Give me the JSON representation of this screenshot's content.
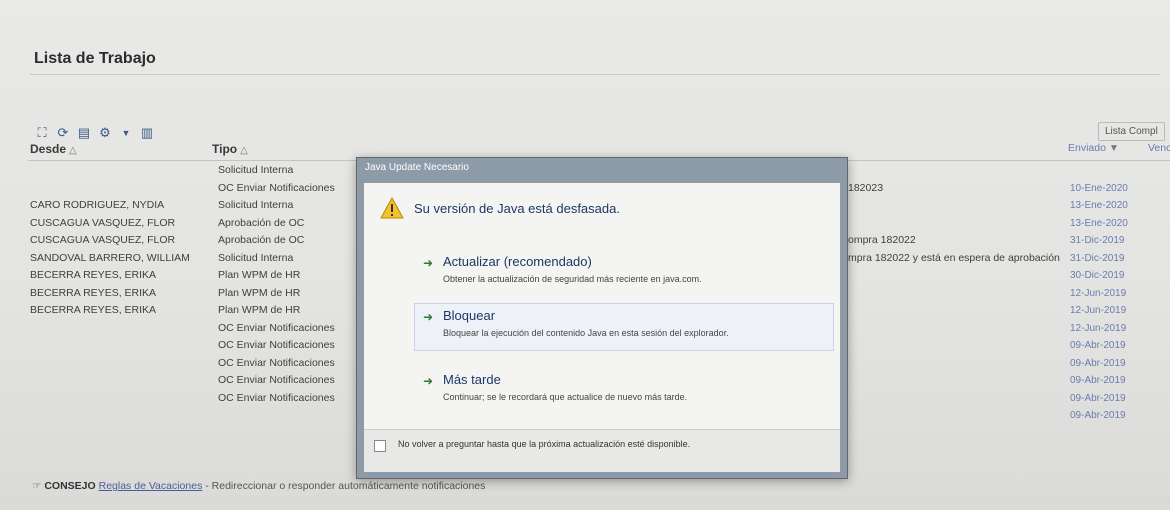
{
  "page": {
    "title": "Lista de Trabajo",
    "toolbar_right_label": "Lista Compl",
    "toolbar_icons": [
      "expand-icon",
      "refresh-icon",
      "export-icon",
      "gear-icon",
      "caret-down-icon",
      "view-icon"
    ]
  },
  "grid": {
    "headers": {
      "desde": "Desde",
      "tipo": "Tipo",
      "asunto": "",
      "enviado": "Enviado",
      "vence": "Venc"
    },
    "rows": [
      {
        "desde": "",
        "tipo": "Solicitud Interna",
        "asunto": "",
        "enviado": ""
      },
      {
        "desde": "",
        "tipo": "OC Enviar Notificaciones",
        "asunto": "182023",
        "enviado": "10-Ene-2020"
      },
      {
        "desde": "CARO RODRIGUEZ, NYDIA",
        "tipo": "Solicitud Interna",
        "asunto": "",
        "enviado": "13-Ene-2020"
      },
      {
        "desde": "CUSCAGUA VASQUEZ, FLOR",
        "tipo": "Aprobación de OC",
        "asunto": "",
        "enviado": "13-Ene-2020"
      },
      {
        "desde": "CUSCAGUA VASQUEZ, FLOR",
        "tipo": "Aprobación de OC",
        "asunto": "ompra 182022",
        "enviado": "31-Dic-2019"
      },
      {
        "desde": "SANDOVAL BARRERO, WILLIAM",
        "tipo": "Solicitud Interna",
        "asunto": "mpra 182022 y está en espera de aprobación",
        "enviado": "31-Dic-2019"
      },
      {
        "desde": "BECERRA REYES, ERIKA",
        "tipo": "Plan WPM de HR",
        "asunto": "",
        "enviado": "30-Dic-2019"
      },
      {
        "desde": "BECERRA REYES, ERIKA",
        "tipo": "Plan WPM de HR",
        "asunto": "",
        "enviado": "12-Jun-2019"
      },
      {
        "desde": "BECERRA REYES, ERIKA",
        "tipo": "Plan WPM de HR",
        "asunto": "",
        "enviado": "12-Jun-2019"
      },
      {
        "desde": "",
        "tipo": "OC Enviar Notificaciones",
        "asunto": "",
        "enviado": "12-Jun-2019"
      },
      {
        "desde": "",
        "tipo": "OC Enviar Notificaciones",
        "asunto": "",
        "enviado": "09-Abr-2019"
      },
      {
        "desde": "",
        "tipo": "OC Enviar Notificaciones",
        "asunto": "",
        "enviado": "09-Abr-2019"
      },
      {
        "desde": "",
        "tipo": "OC Enviar Notificaciones",
        "asunto": "",
        "enviado": "09-Abr-2019"
      },
      {
        "desde": "",
        "tipo": "OC Enviar Notificaciones",
        "asunto": "",
        "enviado": "09-Abr-2019"
      },
      {
        "desde": "",
        "tipo": "",
        "asunto": "",
        "enviado": "09-Abr-2019"
      }
    ]
  },
  "tip": {
    "prefix": "CONSEJO",
    "link": "Reglas de Vacaciones",
    "text": " - Redireccionar o responder automáticamente notificaciones"
  },
  "dialog": {
    "title": "Java Update Necesario",
    "heading": "Su versión de Java está desfasada.",
    "options": [
      {
        "label": "Actualizar (recomendado)",
        "desc": "Obtener la actualización de seguridad más reciente en java.com."
      },
      {
        "label": "Bloquear",
        "desc": "Bloquear la ejecución del contenido Java en esta sesión del explorador."
      },
      {
        "label": "Más tarde",
        "desc": "Continuar; se le recordará que actualice de nuevo más tarde."
      }
    ],
    "checkbox_label": "No volver a preguntar hasta que la próxima actualización esté disponible."
  },
  "colors": {
    "accent": "#1c3866",
    "date": "#6a7cb0",
    "dialog_frame": "#8d9aa8"
  }
}
